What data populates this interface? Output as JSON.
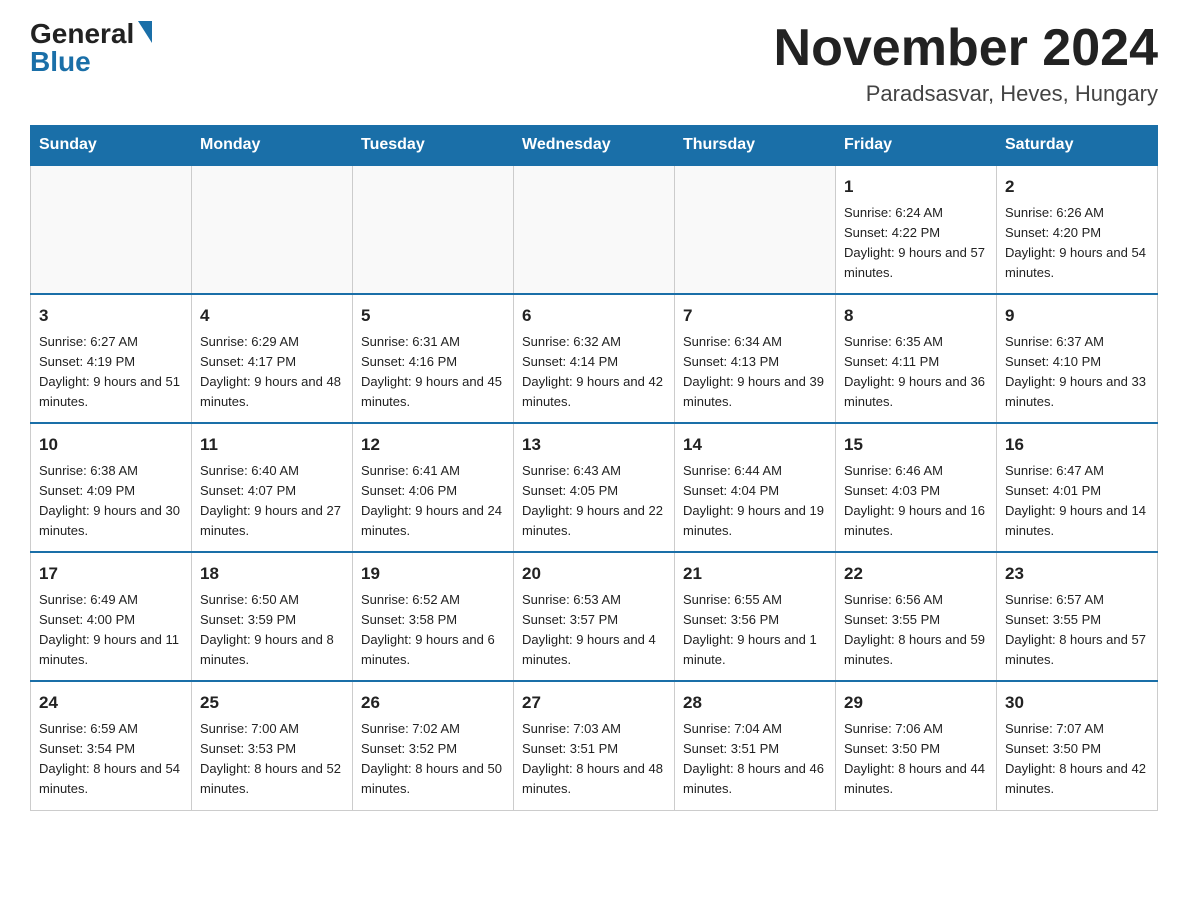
{
  "logo": {
    "general": "General",
    "blue": "Blue"
  },
  "header": {
    "month_year": "November 2024",
    "location": "Paradsasvar, Heves, Hungary"
  },
  "weekdays": [
    "Sunday",
    "Monday",
    "Tuesday",
    "Wednesday",
    "Thursday",
    "Friday",
    "Saturday"
  ],
  "weeks": [
    [
      {
        "day": "",
        "info": ""
      },
      {
        "day": "",
        "info": ""
      },
      {
        "day": "",
        "info": ""
      },
      {
        "day": "",
        "info": ""
      },
      {
        "day": "",
        "info": ""
      },
      {
        "day": "1",
        "info": "Sunrise: 6:24 AM\nSunset: 4:22 PM\nDaylight: 9 hours and 57 minutes."
      },
      {
        "day": "2",
        "info": "Sunrise: 6:26 AM\nSunset: 4:20 PM\nDaylight: 9 hours and 54 minutes."
      }
    ],
    [
      {
        "day": "3",
        "info": "Sunrise: 6:27 AM\nSunset: 4:19 PM\nDaylight: 9 hours and 51 minutes."
      },
      {
        "day": "4",
        "info": "Sunrise: 6:29 AM\nSunset: 4:17 PM\nDaylight: 9 hours and 48 minutes."
      },
      {
        "day": "5",
        "info": "Sunrise: 6:31 AM\nSunset: 4:16 PM\nDaylight: 9 hours and 45 minutes."
      },
      {
        "day": "6",
        "info": "Sunrise: 6:32 AM\nSunset: 4:14 PM\nDaylight: 9 hours and 42 minutes."
      },
      {
        "day": "7",
        "info": "Sunrise: 6:34 AM\nSunset: 4:13 PM\nDaylight: 9 hours and 39 minutes."
      },
      {
        "day": "8",
        "info": "Sunrise: 6:35 AM\nSunset: 4:11 PM\nDaylight: 9 hours and 36 minutes."
      },
      {
        "day": "9",
        "info": "Sunrise: 6:37 AM\nSunset: 4:10 PM\nDaylight: 9 hours and 33 minutes."
      }
    ],
    [
      {
        "day": "10",
        "info": "Sunrise: 6:38 AM\nSunset: 4:09 PM\nDaylight: 9 hours and 30 minutes."
      },
      {
        "day": "11",
        "info": "Sunrise: 6:40 AM\nSunset: 4:07 PM\nDaylight: 9 hours and 27 minutes."
      },
      {
        "day": "12",
        "info": "Sunrise: 6:41 AM\nSunset: 4:06 PM\nDaylight: 9 hours and 24 minutes."
      },
      {
        "day": "13",
        "info": "Sunrise: 6:43 AM\nSunset: 4:05 PM\nDaylight: 9 hours and 22 minutes."
      },
      {
        "day": "14",
        "info": "Sunrise: 6:44 AM\nSunset: 4:04 PM\nDaylight: 9 hours and 19 minutes."
      },
      {
        "day": "15",
        "info": "Sunrise: 6:46 AM\nSunset: 4:03 PM\nDaylight: 9 hours and 16 minutes."
      },
      {
        "day": "16",
        "info": "Sunrise: 6:47 AM\nSunset: 4:01 PM\nDaylight: 9 hours and 14 minutes."
      }
    ],
    [
      {
        "day": "17",
        "info": "Sunrise: 6:49 AM\nSunset: 4:00 PM\nDaylight: 9 hours and 11 minutes."
      },
      {
        "day": "18",
        "info": "Sunrise: 6:50 AM\nSunset: 3:59 PM\nDaylight: 9 hours and 8 minutes."
      },
      {
        "day": "19",
        "info": "Sunrise: 6:52 AM\nSunset: 3:58 PM\nDaylight: 9 hours and 6 minutes."
      },
      {
        "day": "20",
        "info": "Sunrise: 6:53 AM\nSunset: 3:57 PM\nDaylight: 9 hours and 4 minutes."
      },
      {
        "day": "21",
        "info": "Sunrise: 6:55 AM\nSunset: 3:56 PM\nDaylight: 9 hours and 1 minute."
      },
      {
        "day": "22",
        "info": "Sunrise: 6:56 AM\nSunset: 3:55 PM\nDaylight: 8 hours and 59 minutes."
      },
      {
        "day": "23",
        "info": "Sunrise: 6:57 AM\nSunset: 3:55 PM\nDaylight: 8 hours and 57 minutes."
      }
    ],
    [
      {
        "day": "24",
        "info": "Sunrise: 6:59 AM\nSunset: 3:54 PM\nDaylight: 8 hours and 54 minutes."
      },
      {
        "day": "25",
        "info": "Sunrise: 7:00 AM\nSunset: 3:53 PM\nDaylight: 8 hours and 52 minutes."
      },
      {
        "day": "26",
        "info": "Sunrise: 7:02 AM\nSunset: 3:52 PM\nDaylight: 8 hours and 50 minutes."
      },
      {
        "day": "27",
        "info": "Sunrise: 7:03 AM\nSunset: 3:51 PM\nDaylight: 8 hours and 48 minutes."
      },
      {
        "day": "28",
        "info": "Sunrise: 7:04 AM\nSunset: 3:51 PM\nDaylight: 8 hours and 46 minutes."
      },
      {
        "day": "29",
        "info": "Sunrise: 7:06 AM\nSunset: 3:50 PM\nDaylight: 8 hours and 44 minutes."
      },
      {
        "day": "30",
        "info": "Sunrise: 7:07 AM\nSunset: 3:50 PM\nDaylight: 8 hours and 42 minutes."
      }
    ]
  ]
}
